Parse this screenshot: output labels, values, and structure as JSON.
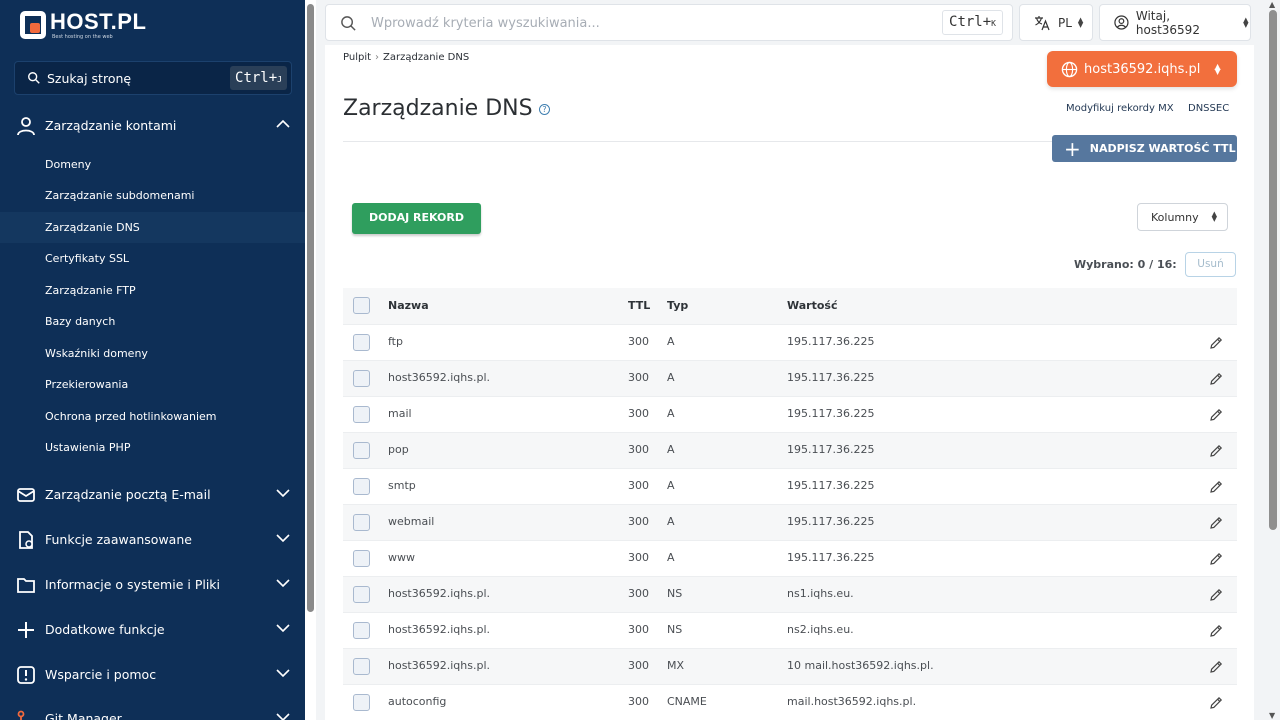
{
  "brand": {
    "name": "HOST.PL",
    "tagline": "Best hosting on the web",
    "accent": "#f26a3d",
    "sidebar_bg": "#0e2f57"
  },
  "sidebar": {
    "search_label": "Szukaj stronę",
    "shortcut": "Ctrl+",
    "shortcut_key": "J",
    "sections": [
      {
        "title": "Zarządzanie kontami",
        "icon": "user-icon",
        "expanded": true
      },
      {
        "title": "Zarządzanie pocztą E-mail",
        "icon": "mail-icon",
        "expanded": false
      },
      {
        "title": "Funkcje zaawansowane",
        "icon": "settings-doc-icon",
        "expanded": false
      },
      {
        "title": "Informacje o systemie i Pliki",
        "icon": "folder-icon",
        "expanded": false
      },
      {
        "title": "Dodatkowe funkcje",
        "icon": "plus-icon",
        "expanded": false
      },
      {
        "title": "Wsparcie i pomoc",
        "icon": "alert-icon",
        "expanded": false
      },
      {
        "title": "Git Manager",
        "icon": "git-icon",
        "expanded": false
      }
    ],
    "items": [
      {
        "label": "Domeny"
      },
      {
        "label": "Zarządzanie subdomenami"
      },
      {
        "label": "Zarządzanie DNS",
        "active": true
      },
      {
        "label": "Certyfikaty SSL"
      },
      {
        "label": "Zarządzanie FTP"
      },
      {
        "label": "Bazy danych"
      },
      {
        "label": "Wskaźniki domeny"
      },
      {
        "label": "Przekierowania"
      },
      {
        "label": "Ochrona przed hotlinkowaniem"
      },
      {
        "label": "Ustawienia PHP"
      }
    ]
  },
  "topbar": {
    "search_placeholder": "Wprowadź kryteria wyszukiwania...",
    "shortcut": "Ctrl+",
    "shortcut_key": "K",
    "language": "PL",
    "user_greeting": "Witaj, host36592"
  },
  "main": {
    "breadcrumb": [
      "Pulpit",
      "Zarządzanie DNS"
    ],
    "domain_selector": "host36592.iqhs.pl",
    "page_title": "Zarządzanie DNS",
    "links": [
      "Modyfikuj rekordy MX",
      "DNSSEC"
    ],
    "ttl_button": "NADPISZ WARTOŚĆ TTL",
    "add_button": "DODAJ REKORD",
    "columns_button": "Kolumny",
    "selected_text": "Wybrano: 0 / 16:",
    "delete_button": "Usuń",
    "table": {
      "headers": [
        "Nazwa",
        "TTL",
        "Typ",
        "Wartość"
      ],
      "rows": [
        {
          "name": "ftp",
          "ttl": "300",
          "type": "A",
          "value": "195.117.36.225"
        },
        {
          "name": "host36592.iqhs.pl.",
          "ttl": "300",
          "type": "A",
          "value": "195.117.36.225"
        },
        {
          "name": "mail",
          "ttl": "300",
          "type": "A",
          "value": "195.117.36.225"
        },
        {
          "name": "pop",
          "ttl": "300",
          "type": "A",
          "value": "195.117.36.225"
        },
        {
          "name": "smtp",
          "ttl": "300",
          "type": "A",
          "value": "195.117.36.225"
        },
        {
          "name": "webmail",
          "ttl": "300",
          "type": "A",
          "value": "195.117.36.225"
        },
        {
          "name": "www",
          "ttl": "300",
          "type": "A",
          "value": "195.117.36.225"
        },
        {
          "name": "host36592.iqhs.pl.",
          "ttl": "300",
          "type": "NS",
          "value": "ns1.iqhs.eu."
        },
        {
          "name": "host36592.iqhs.pl.",
          "ttl": "300",
          "type": "NS",
          "value": "ns2.iqhs.eu."
        },
        {
          "name": "host36592.iqhs.pl.",
          "ttl": "300",
          "type": "MX",
          "value": "10 mail.host36592.iqhs.pl."
        },
        {
          "name": "autoconfig",
          "ttl": "300",
          "type": "CNAME",
          "value": "mail.host36592.iqhs.pl."
        }
      ]
    }
  }
}
